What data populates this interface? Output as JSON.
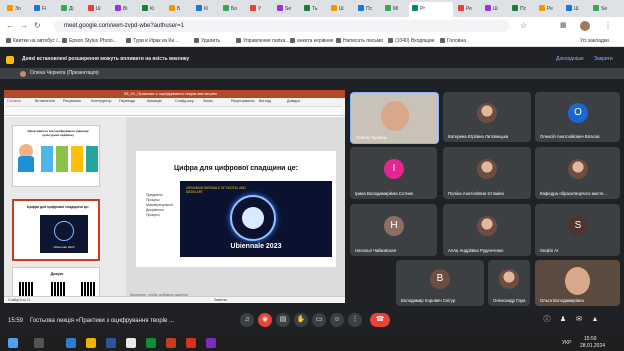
{
  "browser": {
    "tabs": [
      "Зо",
      "Fi",
      "Ді",
      "Ш",
      "Ві",
      "Кі",
      "Б",
      "Кі",
      "Бо",
      "У",
      "Se",
      "Ть",
      "Ш",
      "Пс",
      "Мі",
      "Ре",
      "Ш",
      "Пс",
      "Ре",
      "Ш",
      "Se"
    ],
    "active_tab": "Pr",
    "url": "meet.google.com/ewn-zvpd-wbe?authuser=1",
    "bookmarks": [
      "Квитки на автобус і...",
      "Epson Stylus Photo...",
      "Тури в Ирак из Ки...",
      "Удалить",
      "Управление папка...",
      "анкета керівник",
      "Написать письмо",
      "(1040) Входящие",
      "Головна"
    ],
    "all_bookmarks": "Усі закладки"
  },
  "banner": {
    "text": "Деякі встановлені розширення можуть впливати на якість виклику",
    "details": "Докладніше",
    "close": "Закрити"
  },
  "presenter": {
    "label": "Олена Чернега (Презентація)"
  },
  "presentation": {
    "file": "08_01_Практики з оцифрування творів мистецтва",
    "ribbon_tabs": [
      "Головна",
      "Вставлення",
      "Рисування",
      "Конструктор",
      "Переходи",
      "Анімація",
      "Слайд-шоу",
      "Запис",
      "Рецензування",
      "Вигляд",
      "Довідка"
    ],
    "slide_title": "Цифра для цифрової спадщини це:",
    "slide_bullets": [
      "Предметы",
      "Процесс",
      "Масив/результат",
      "Документы",
      "Процесс"
    ],
    "slide_image_caption": "Ubiennale 2023",
    "slide_image_header": "UKRAINIAN BIENNALE OF DIGITAL AND MEDIA ART",
    "thumb1_title": "Ефективність від оцифрування (одиниці культурних надбань)",
    "thumb2_title": "Цифра для цифрової спадщини це:",
    "thumb2_caption": "Ubiennale 2023",
    "thumb3_title": "Дякую",
    "notes": "Щелкните, чтобы добавить заметки",
    "status_left": "Слайд 5 из 11",
    "status_right": "Заметки"
  },
  "tiles": [
    {
      "name": "Олена Чернега",
      "kind": "video"
    },
    {
      "name": "Катерина Юріївна Литовецька",
      "kind": "photo"
    },
    {
      "name": "Олексій Анатолійович Власов",
      "kind": "letter",
      "letter": "О",
      "color": "#1967d2"
    },
    {
      "name": "Ірина Володимирівна Сотник",
      "kind": "letter",
      "letter": "І",
      "color": "#e52592"
    },
    {
      "name": "Поліна Анатоліївна Істоміна",
      "kind": "photo"
    },
    {
      "name": "Кафедра образотворчого мисте...",
      "kind": "photo"
    },
    {
      "name": "Наталья Чайковская",
      "kind": "letter",
      "letter": "Н",
      "color": "#8d6e63"
    },
    {
      "name": "Алла Андріївна Руденченко",
      "kind": "photo"
    },
    {
      "name": "Seqkin Ar",
      "kind": "letter",
      "letter": "S",
      "color": "#4e342e"
    },
    {
      "name": "Володимир Ігорович Снігур",
      "kind": "letter",
      "letter": "В",
      "color": "#6d4c41"
    },
    {
      "name": "Олександр Гора",
      "kind": "photo"
    },
    {
      "name": "Ольга Володимирівна",
      "kind": "video"
    }
  ],
  "bottombar": {
    "time": "15:59",
    "meeting": "Гостьова лекція «Практики з оцифрування творів ..."
  },
  "taskbar": {
    "lang": "УКР",
    "clock_time": "15:59",
    "clock_date": "28.01.2024"
  }
}
